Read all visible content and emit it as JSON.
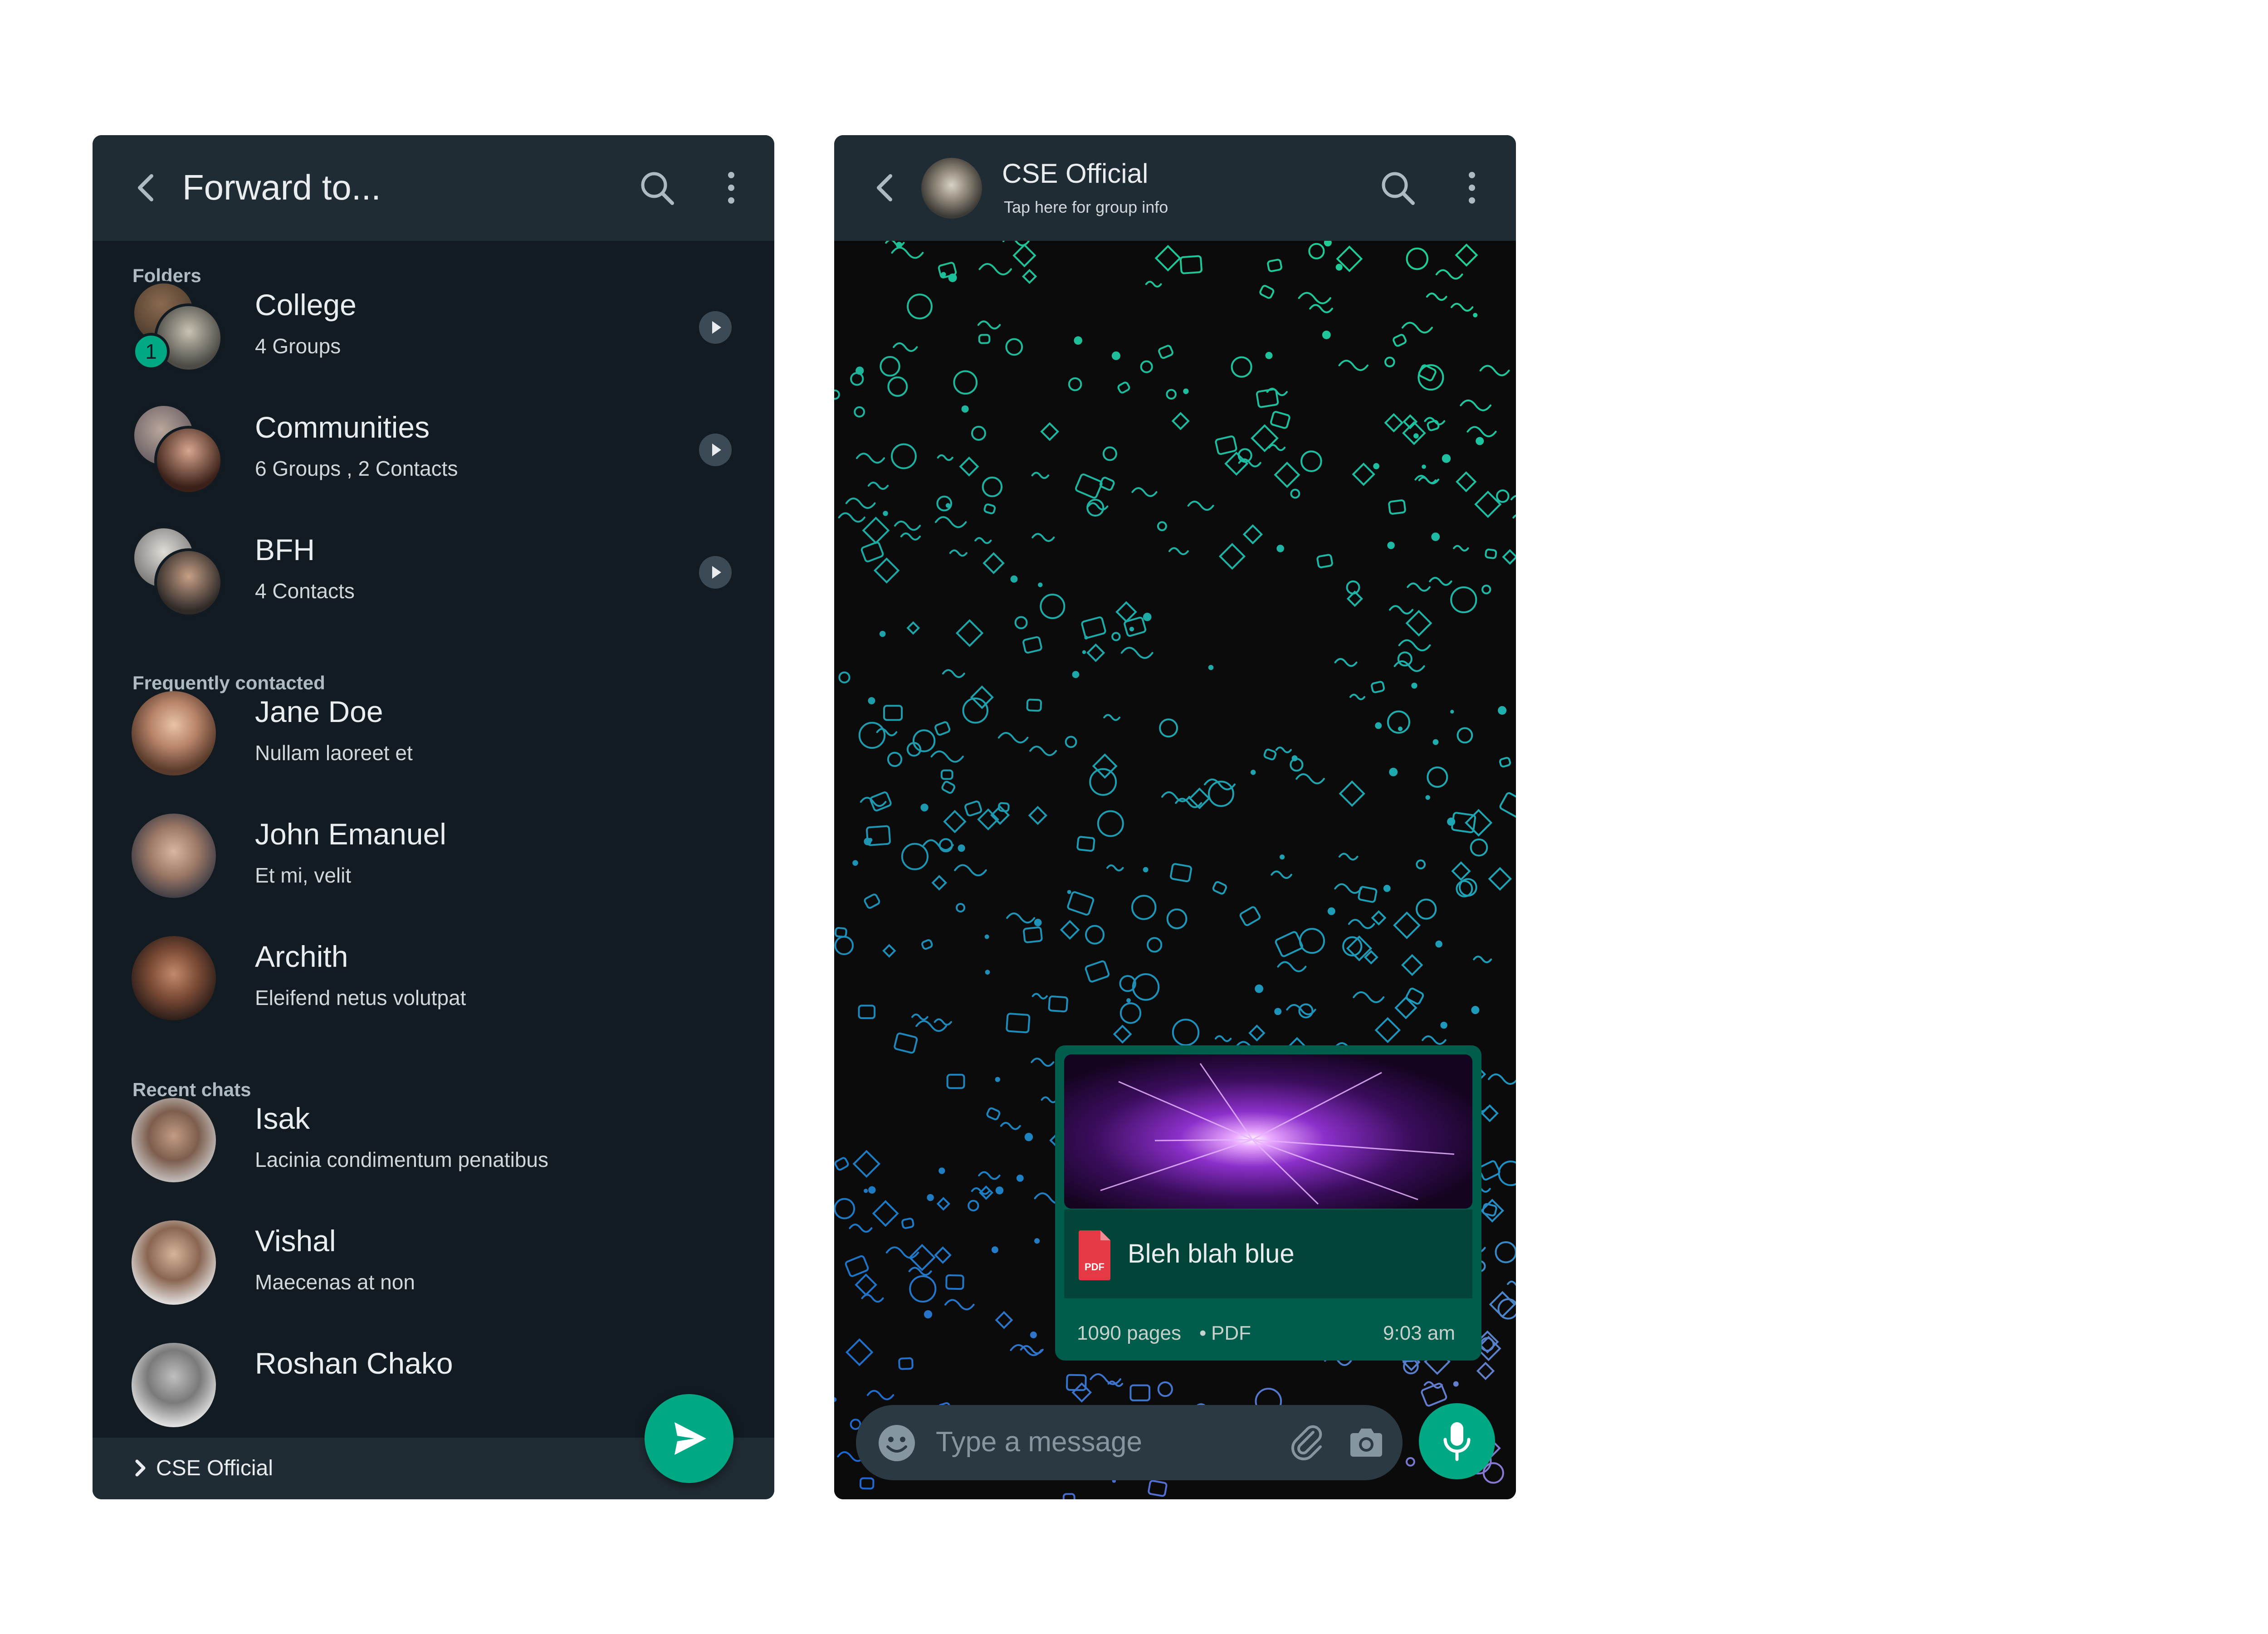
{
  "forward": {
    "title": "Forward to...",
    "sections": {
      "folders": "Folders",
      "frequent": "Frequently contacted",
      "recent": "Recent chats"
    },
    "folders": [
      {
        "name": "College",
        "sub": "4 Groups",
        "badge": "1"
      },
      {
        "name": "Communities",
        "sub": "6 Groups , 2 Contacts"
      },
      {
        "name": "BFH",
        "sub": "4 Contacts"
      }
    ],
    "frequent": [
      {
        "name": "Jane Doe",
        "sub": "Nullam laoreet et"
      },
      {
        "name": "John Emanuel",
        "sub": "Et mi, velit"
      },
      {
        "name": "Archith",
        "sub": "Eleifend netus volutpat"
      }
    ],
    "recent": [
      {
        "name": "Isak",
        "sub": "Lacinia condimentum penatibus"
      },
      {
        "name": "Vishal",
        "sub": "Maecenas at non"
      },
      {
        "name": "Roshan Chako",
        "sub": ""
      }
    ],
    "selected_bar": "CSE Official"
  },
  "chat": {
    "name": "CSE Official",
    "subtitle": "Tap here for group info",
    "message": {
      "doc_name": "Bleh blah blue",
      "pages": "1090 pages",
      "type": "PDF",
      "pdf_label": "PDF",
      "time": "9:03 am"
    },
    "input_placeholder": "Type a message"
  },
  "colors": {
    "accent": "#00a884",
    "header": "#202c33",
    "background": "#111b21",
    "bubble": "#005c4b"
  },
  "icons": [
    "back-icon",
    "search-icon",
    "more-vert-icon",
    "chevron-right-icon",
    "send-icon",
    "emoji-icon",
    "attach-icon",
    "camera-icon",
    "mic-icon",
    "pdf-icon"
  ]
}
